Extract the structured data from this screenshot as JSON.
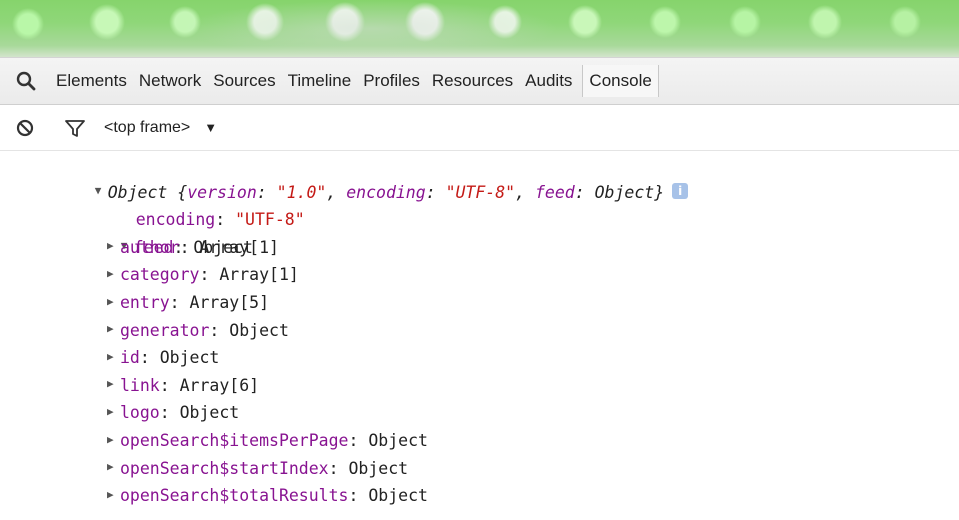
{
  "tabs": [
    "Elements",
    "Network",
    "Sources",
    "Timeline",
    "Profiles",
    "Resources",
    "Audits",
    "Console"
  ],
  "selected_tab": "Console",
  "toolbar": {
    "frame": "<top frame>"
  },
  "console": {
    "root": "Object {version: \"1.0\", encoding: \"UTF-8\", feed: Object}",
    "root_parts": {
      "prefix": "Object {",
      "k1": "version",
      "v1": "\"1.0\"",
      "k2": "encoding",
      "v2": "\"UTF-8\"",
      "k3": "feed",
      "v3": "Object",
      "suffix": "}"
    },
    "encoding": {
      "key": "encoding",
      "value": "\"UTF-8\""
    },
    "feed": {
      "key": "feed",
      "value": "Object"
    },
    "feed_items": [
      {
        "key": "author",
        "value": "Array[1]"
      },
      {
        "key": "category",
        "value": "Array[1]"
      },
      {
        "key": "entry",
        "value": "Array[5]"
      },
      {
        "key": "generator",
        "value": "Object"
      },
      {
        "key": "id",
        "value": "Object"
      },
      {
        "key": "link",
        "value": "Array[6]"
      },
      {
        "key": "logo",
        "value": "Object"
      },
      {
        "key": "openSearch$itemsPerPage",
        "value": "Object"
      },
      {
        "key": "openSearch$startIndex",
        "value": "Object"
      },
      {
        "key": "openSearch$totalResults",
        "value": "Object"
      }
    ]
  }
}
